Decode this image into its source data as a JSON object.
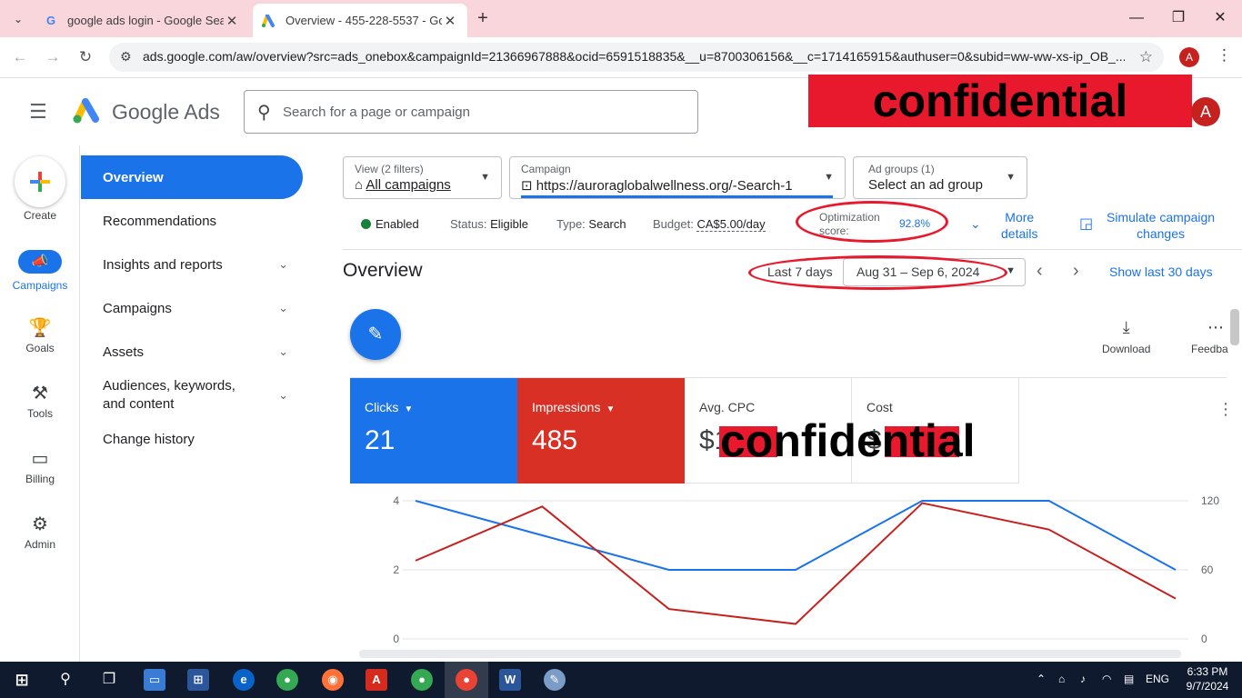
{
  "browser": {
    "tabs": [
      {
        "title": "google ads login - Google Sear",
        "favicon": "G",
        "favicon_color": "#4285f4"
      },
      {
        "title": "Overview - 455-228-5537 - Goo",
        "favicon": "ads-logo-icon"
      }
    ],
    "url": "ads.google.com/aw/overview?src=ads_onebox&campaignId=21366967888&ocid=6591518835&__u=8700306156&__c=1714165915&authuser=0&subid=ww-ww-xs-ip_OB_...",
    "profile_letter": "A"
  },
  "header": {
    "brand_google": "Google",
    "brand_ads": "Ads",
    "search_placeholder": "Search for a page or campaign",
    "redaction_text": "confidential",
    "avatar_letter": "A"
  },
  "rail": [
    {
      "label": "Create",
      "icon": "plus-icon"
    },
    {
      "label": "Campaigns",
      "icon": "megaphone-icon",
      "selected": true
    },
    {
      "label": "Goals",
      "icon": "trophy-icon"
    },
    {
      "label": "Tools",
      "icon": "tools-icon"
    },
    {
      "label": "Billing",
      "icon": "credit-card-icon"
    },
    {
      "label": "Admin",
      "icon": "gear-icon"
    }
  ],
  "nav": [
    {
      "label": "Overview",
      "active": true
    },
    {
      "label": "Recommendations"
    },
    {
      "label": "Insights and reports",
      "expandable": true
    },
    {
      "label": "Campaigns",
      "expandable": true
    },
    {
      "label": "Assets",
      "expandable": true
    },
    {
      "label": "Audiences, keywords, and content",
      "expandable": true
    },
    {
      "label": "Change history"
    }
  ],
  "filters": {
    "view_label": "View (2 filters)",
    "view_value": "All campaigns",
    "campaign_label": "Campaign",
    "campaign_value": "https://auroraglobalwellness.org/-Search-1",
    "adgroups_label": "Ad groups (1)",
    "adgroups_value": "Select an ad group"
  },
  "status": {
    "enabled": "Enabled",
    "status_label": "Status:",
    "status_value": "Eligible",
    "type_label": "Type:",
    "type_value": "Search",
    "budget_label": "Budget:",
    "budget_value": "CA$5.00/day",
    "opt_label_1": "Optimization",
    "opt_label_2": "score:",
    "opt_value": "92.8%",
    "more_details_1": "More",
    "more_details_2": "details",
    "simulate_1": "Simulate campaign",
    "simulate_2": "changes"
  },
  "overview": {
    "title": "Overview",
    "date_preset": "Last 7 days",
    "date_range": "Aug 31 – Sep 6, 2024",
    "show_last": "Show last 30 days",
    "download": "Download",
    "feedback": "Feedba"
  },
  "scorecards": [
    {
      "label": "Clicks",
      "value": "21"
    },
    {
      "label": "Impressions",
      "value": "485"
    },
    {
      "label": "Avg. CPC",
      "value": "$1"
    },
    {
      "label": "Cost",
      "value": "$"
    }
  ],
  "redaction_mid": "confidential",
  "chart_data": {
    "type": "line",
    "x": [
      1,
      2,
      3,
      4,
      5,
      6,
      7
    ],
    "series": [
      {
        "values": [
          4,
          3,
          2,
          2,
          4,
          4,
          2
        ],
        "color": "#1a73e8",
        "axis": "left"
      },
      {
        "values": [
          68,
          115,
          26,
          13,
          118,
          95,
          35
        ],
        "color": "#c5221f",
        "axis": "right"
      }
    ],
    "left_ticks": [
      "4",
      "2",
      "0"
    ],
    "right_ticks": [
      "120",
      "60",
      "0"
    ],
    "ylim_left": [
      0,
      4
    ],
    "ylim_right": [
      0,
      120
    ],
    "grid": true
  },
  "taskbar": {
    "lang": "ENG",
    "time": "6:33 PM",
    "date": "9/7/2024"
  }
}
